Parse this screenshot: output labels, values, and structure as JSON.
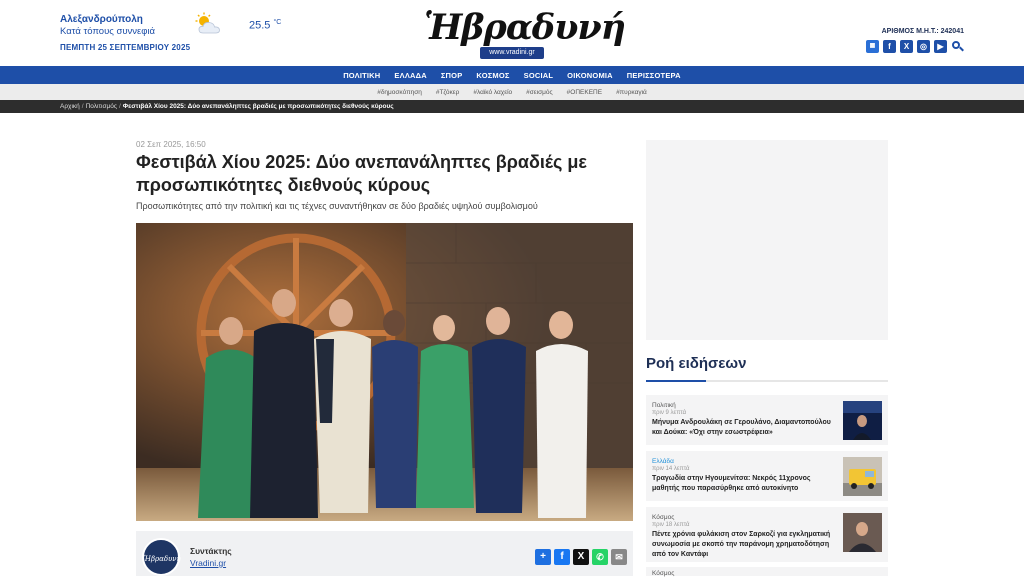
{
  "header": {
    "city": "Αλεξανδρούπολη",
    "weather_desc": "Κατά τόπους συννεφιά",
    "date": "ΠΕΜΠΤΗ 25 ΣΕΠΤΕΜΒΡΙΟΥ 2025",
    "temperature": "25.5",
    "temp_unit": "°C",
    "logo_text": "Ἡβραδυνή",
    "logo_url": "www.vradini.gr",
    "mht": "ΑΡΙΘΜΟΣ Μ.Η.Τ.: 242041",
    "social_icons": [
      "app-icon",
      "facebook-icon",
      "x-icon",
      "instagram-icon",
      "youtube-icon",
      "search-icon"
    ]
  },
  "nav": [
    "ΠΟΛΙΤΙΚΗ",
    "ΕΛΛΑΔΑ",
    "ΣΠΟΡ",
    "ΚΟΣΜΟΣ",
    "SOCIAL",
    "ΟΙΚΟΝΟΜΙΑ",
    "ΠΕΡΙΣΣΟΤΕΡΑ"
  ],
  "tags": [
    "#δημοσκόπηση",
    "#Τζόκερ",
    "#λαϊκό λαχείο",
    "#σεισμός",
    "#ΟΠΕΚΕΠΕ",
    "#πυρκαγιά"
  ],
  "breadcrumb": {
    "home": "Αρχική",
    "section": "Πολιτισμός",
    "current": "Φεστιβάλ Χίου 2025: Δύο ανεπανάληπτες βραδιές με προσωπικότητες διεθνούς κύρους"
  },
  "article": {
    "date": "02 Σεπ 2025, 16:50",
    "title": "Φεστιβάλ Χίου 2025: Δύο ανεπανάληπτες βραδιές με προσωπικότητες διεθνούς κύρους",
    "subtitle": "Προσωπικότητες από την πολιτική και τις τέχνες συναντήθηκαν σε δύο βραδιές υψηλού συμβολισμού",
    "author_role": "Συντάκτης",
    "author_name": "Vradini.gr",
    "author_avatar_text": "Ἡβραδυνή"
  },
  "share_buttons": [
    {
      "icon": "plus-icon",
      "color": "#1e6fe0"
    },
    {
      "icon": "facebook-icon",
      "color": "#1877f2"
    },
    {
      "icon": "x-icon",
      "color": "#111111"
    },
    {
      "icon": "whatsapp-icon",
      "color": "#25d366"
    },
    {
      "icon": "email-icon",
      "color": "#888888"
    }
  ],
  "sidebar": {
    "feed_title": "Ροή ειδήσεων",
    "items": [
      {
        "category": "Πολιτική",
        "ago": "πριν 9 λεπτά",
        "headline": "Μήνυμα Ανδρουλάκη σε Γερουλάνο, Διαμαντοπούλου και Δούκα: «Όχι στην εσωστρέφεια»",
        "cat_color": "#555555"
      },
      {
        "category": "Ελλάδα",
        "ago": "πριν 14 λεπτά",
        "headline": "Τραγωδία στην Ηγουμενίτσα: Νεκρός 11χρονος μαθητής που παρασύρθηκε από αυτοκίνητο",
        "cat_color": "#1e8fd8"
      },
      {
        "category": "Κόσμος",
        "ago": "πριν 18 λεπτά",
        "headline": "Πέντε χρόνια φυλάκιση στον Σαρκοζί για εγκληματική συνωμοσία με σκοπό την παράνομη χρηματοδότηση από τον Καντάφι",
        "cat_color": "#555555"
      },
      {
        "category": "Κόσμος",
        "ago": "",
        "headline": "",
        "cat_color": "#555555"
      }
    ]
  }
}
